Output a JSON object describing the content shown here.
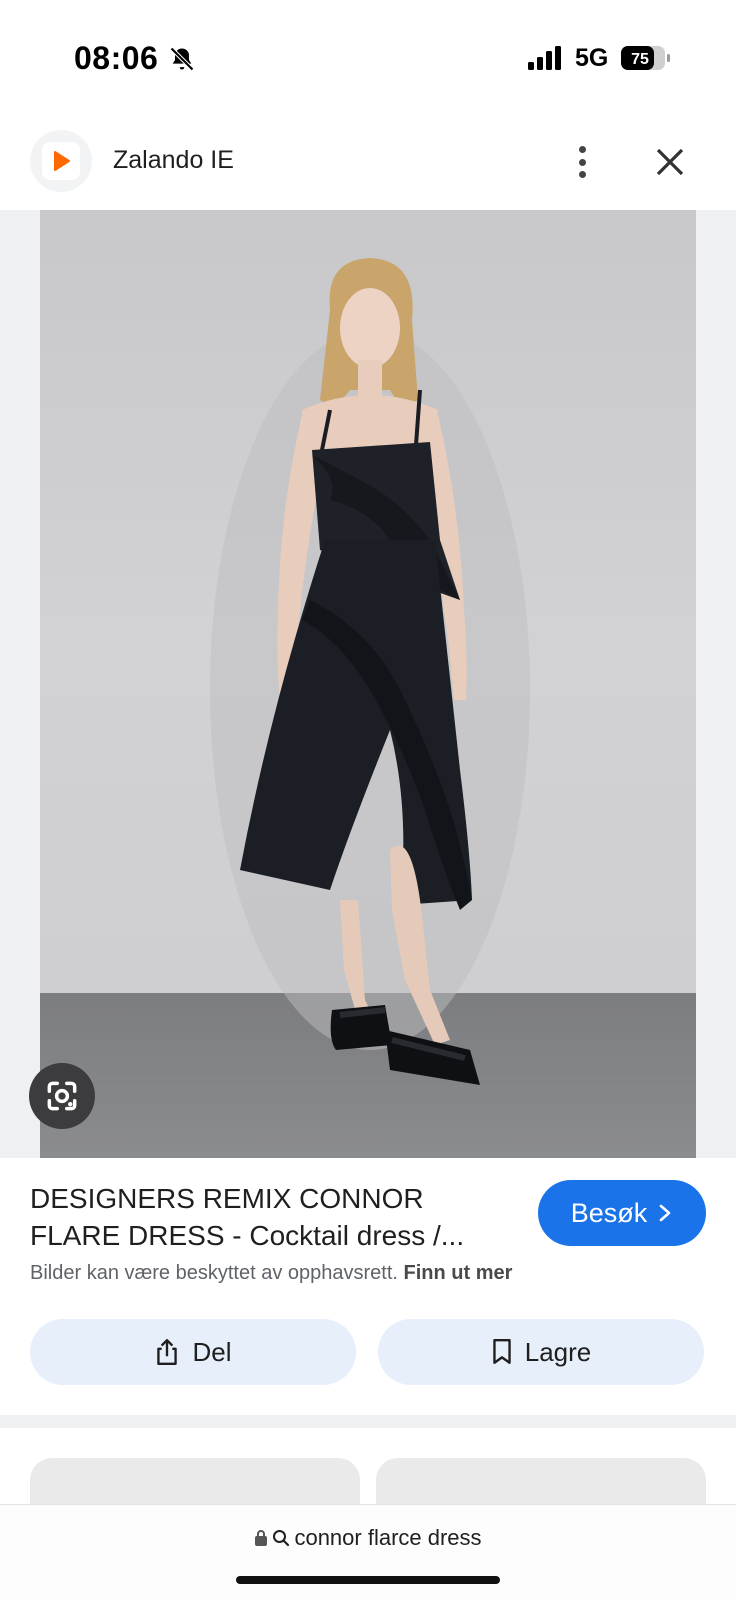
{
  "status_bar": {
    "time": "08:06",
    "network": "5G",
    "battery": "75",
    "icons": [
      "bell-slash-icon",
      "signal-icon",
      "battery-icon"
    ]
  },
  "header": {
    "site_name": "Zalando IE",
    "favicon_color": "#ff6900",
    "icons": [
      "more-vert-icon",
      "close-icon"
    ]
  },
  "product": {
    "title": "DESIGNERS REMIX CONNOR FLARE DRESS - Cocktail dress /...",
    "visit_label": "Besøk",
    "copyright_text": "Bilder kan være beskyttet av opphavsrett.",
    "copyright_link": "Finn ut mer"
  },
  "actions": {
    "share_label": "Del",
    "save_label": "Lagre"
  },
  "url_bar": {
    "query": "connor flarce dress"
  },
  "colors": {
    "accent": "#1a73e8",
    "action_bg": "#e7effb"
  }
}
